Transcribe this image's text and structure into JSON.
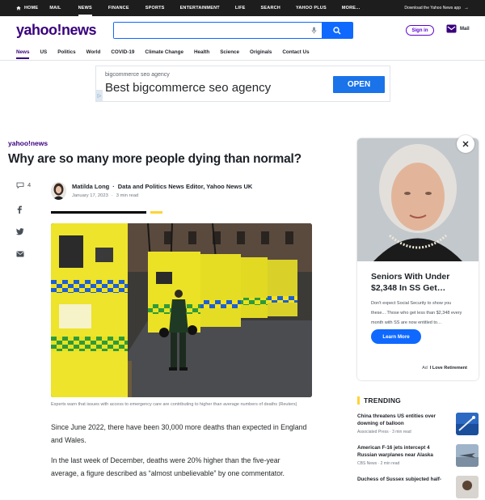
{
  "topnav": {
    "items": [
      "HOME",
      "MAIL",
      "NEWS",
      "FINANCE",
      "SPORTS",
      "ENTERTAINMENT",
      "LIFE",
      "SEARCH",
      "YAHOO PLUS",
      "MORE..."
    ],
    "active": "NEWS",
    "download_label": "Download the Yahoo News app"
  },
  "header": {
    "logo": "yahoo!news",
    "search_placeholder": "",
    "signin_label": "Sign in",
    "mail_label": "Mail"
  },
  "subnav": {
    "items": [
      "News",
      "US",
      "Politics",
      "World",
      "COVID-19",
      "Climate Change",
      "Health",
      "Science",
      "Originals",
      "Contact Us"
    ],
    "active": "News"
  },
  "banner_ad": {
    "small_text": "bigcommerce seo agency",
    "headline": "Best bigcommerce seo agency",
    "button_label": "OPEN"
  },
  "article": {
    "brand": "yahoo!news",
    "headline": "Why are so many more people dying than normal?",
    "comment_count": "4",
    "author_name": "Matilda Long",
    "author_role": "Data and Politics News Editor, Yahoo News UK",
    "date": "January 17, 2023",
    "read_time": "3 min read",
    "caption": "Experts warn that issues with access to emergency care are contributing to higher than average numbers of deaths (Reuters)",
    "paragraphs": [
      "Since June 2022, there have been 30,000 more deaths than expected in England and Wales.",
      "In the last week of December, deaths were 20% higher than the five-year average, a figure described as “almost unbelievable” by one commentator."
    ]
  },
  "rail_ad": {
    "title": "Seniors With Under $2,348 In SS Get…",
    "body": "Don't expect Social Security to show you these... Those who get less than $2,348 every month with SS are now entitled to…",
    "button_label": "Learn More",
    "ad_label": "Ad",
    "sponsor": "I Love Retirement"
  },
  "trending": {
    "heading": "TRENDING",
    "items": [
      {
        "title": "China threatens US entities over downing of balloon",
        "source": "Associated Press",
        "time": "3 min read"
      },
      {
        "title": "American F-16 jets intercept 4 Russian warplanes near Alaska",
        "source": "CBS News",
        "time": "2 min read"
      },
      {
        "title": "Duchess of Sussex subjected half-",
        "source": "",
        "time": ""
      }
    ]
  },
  "colors": {
    "brand_purple": "#39007d",
    "link_blue": "#0f69ff",
    "accent_yellow": "#ffd333",
    "topbar_black": "#1d1d1d"
  }
}
